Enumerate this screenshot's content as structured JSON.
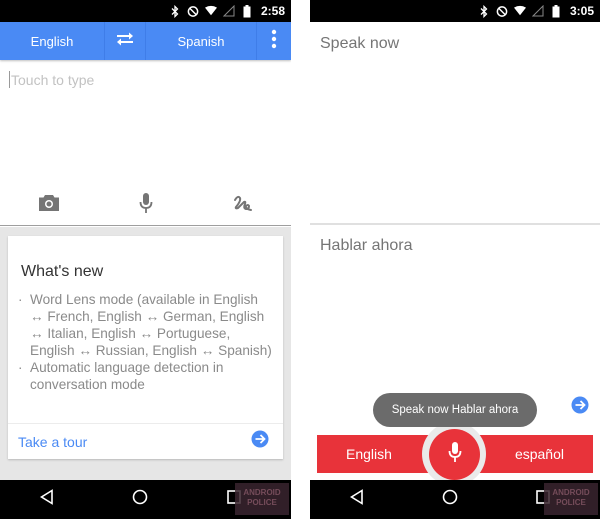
{
  "left": {
    "status_bar": {
      "icons": [
        "bluetooth-icon",
        "do-not-disturb-icon",
        "wifi-icon",
        "cell-signal-icon",
        "battery-icon"
      ],
      "time": "2:58"
    },
    "toolbar": {
      "source_language": "English",
      "swap_icon": "swap-arrows-icon",
      "target_language": "Spanish",
      "menu_icon": "more-vert-icon"
    },
    "input": {
      "placeholder": "Touch to type",
      "value": ""
    },
    "input_tools": [
      {
        "name": "camera",
        "icon": "camera-icon"
      },
      {
        "name": "voice",
        "icon": "microphone-icon"
      },
      {
        "name": "handwriting",
        "icon": "handwriting-icon"
      }
    ],
    "whats_new_card": {
      "title": "What's new",
      "items": [
        "Word Lens mode (available in English ↔ French, English ↔ German, English ↔ Italian, English ↔ Portuguese, English ↔ Russian, English ↔ Spanish)",
        "Automatic language detection in conversation mode"
      ],
      "action_label": "Take a tour",
      "action_icon": "arrow-forward-circle-icon"
    },
    "nav_bar": [
      "back-icon",
      "home-icon",
      "recents-icon"
    ],
    "watermark": {
      "line1": "ANDROID",
      "line2": "POLICE"
    }
  },
  "right": {
    "status_bar": {
      "icons": [
        "bluetooth-icon",
        "do-not-disturb-icon",
        "wifi-icon",
        "cell-signal-icon",
        "battery-icon"
      ],
      "time": "3:05"
    },
    "top_prompt": "Speak now",
    "bottom_prompt": "Hablar ahora",
    "toast": "Speak now Hablar ahora",
    "voice_bar": {
      "left_language": "English",
      "right_language": "español",
      "mic_icon": "microphone-icon"
    },
    "nav_bar": [
      "back-icon",
      "home-icon",
      "recents-icon"
    ],
    "watermark": {
      "line1": "ANDROID",
      "line2": "POLICE"
    }
  },
  "colors": {
    "toolbar_blue": "#4a8af4",
    "link_blue": "#4a8af4",
    "voice_red": "#e8333a",
    "card_bg_gray": "#e6e6e6",
    "toast_gray": "#6b6b6b"
  }
}
